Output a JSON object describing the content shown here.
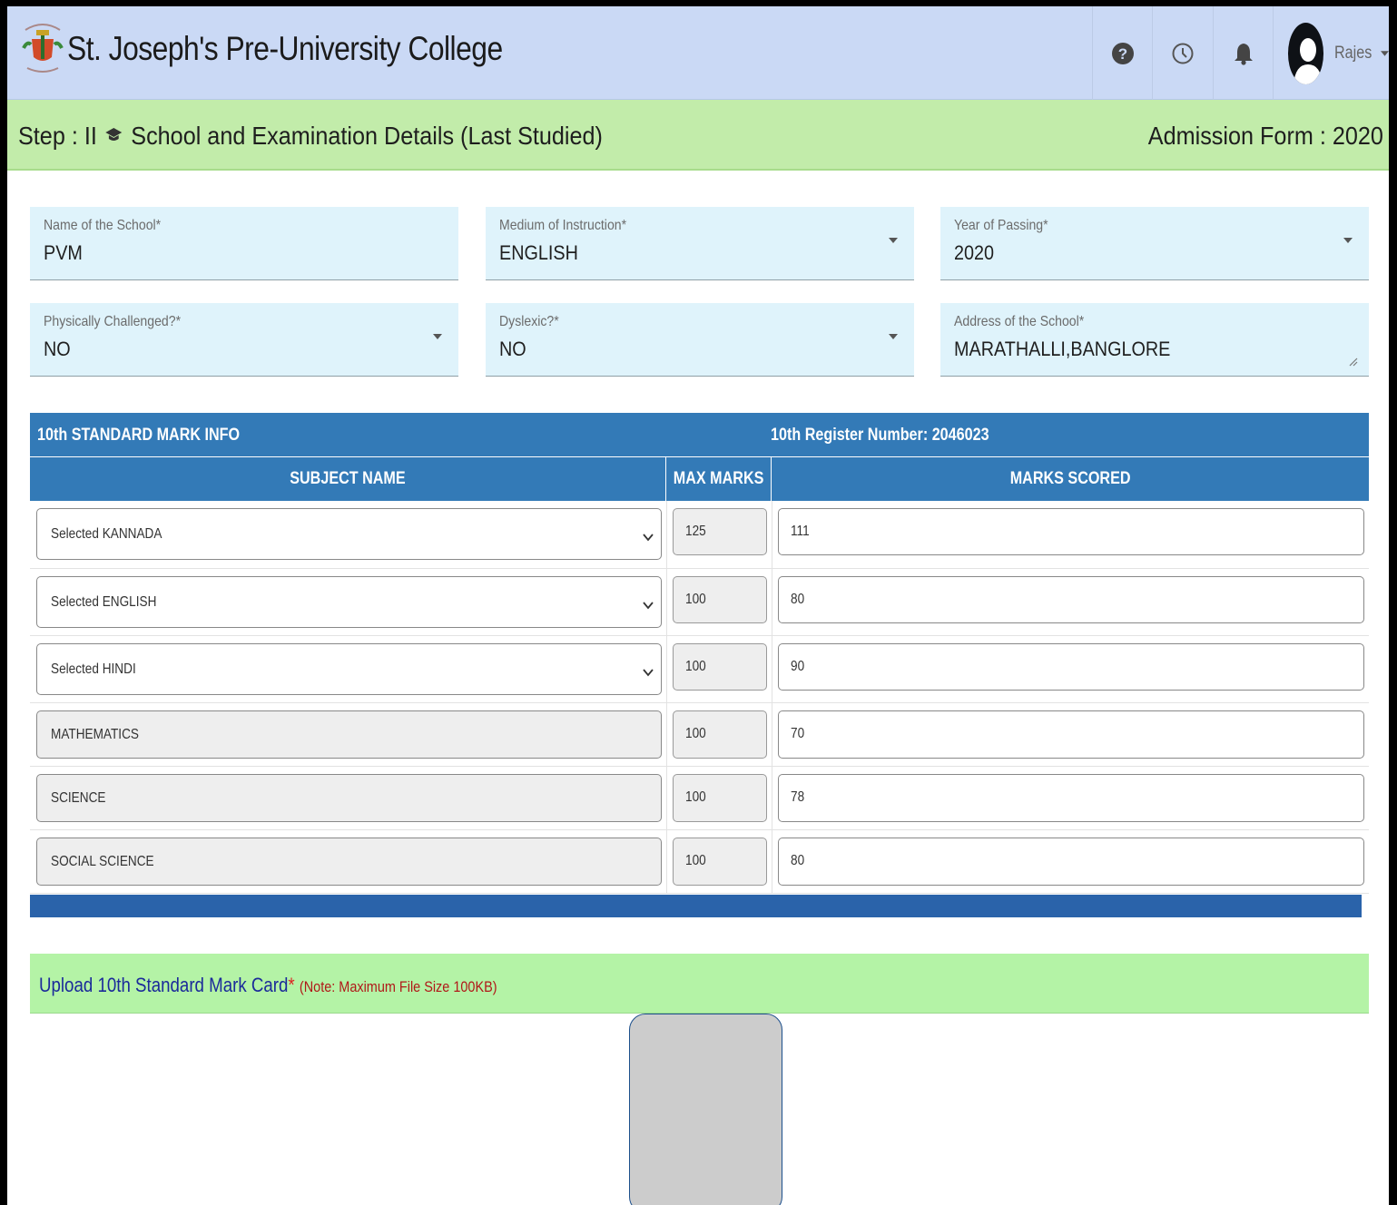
{
  "header": {
    "college_name": "St. Joseph's Pre-University College",
    "icons": [
      "help-icon",
      "clock-icon",
      "bell-icon"
    ],
    "user_name": "Rajes"
  },
  "step": {
    "label": "Step : II",
    "icon": "graduation-cap-icon",
    "title": "School and Examination Details (Last Studied)",
    "form_label": "Admission Form : 2020"
  },
  "fields": {
    "school_name": {
      "label": "Name of the School*",
      "value": "PVM"
    },
    "medium": {
      "label": "Medium of Instruction*",
      "value": "ENGLISH"
    },
    "year_of_passing": {
      "label": "Year of Passing*",
      "value": "2020"
    },
    "physically_challenged": {
      "label": "Physically Challenged?*",
      "value": "NO"
    },
    "dyslexic": {
      "label": "Dyslexic?*",
      "value": "NO"
    },
    "school_address": {
      "label": "Address of the School*",
      "value": "MARATHALLI,BANGLORE"
    }
  },
  "marks_table": {
    "title": "10th STANDARD MARK INFO",
    "register_number": "10th Register Number: 2046023",
    "columns": [
      "SUBJECT NAME",
      "MAX MARKS",
      "MARKS SCORED"
    ],
    "rows": [
      {
        "subject": "Selected KANNADA",
        "max": "125",
        "scored": "111",
        "selectable": true
      },
      {
        "subject": "Selected ENGLISH",
        "max": "100",
        "scored": "80",
        "selectable": true
      },
      {
        "subject": "Selected HINDI",
        "max": "100",
        "scored": "90",
        "selectable": true
      },
      {
        "subject": "MATHEMATICS",
        "max": "100",
        "scored": "70",
        "selectable": false
      },
      {
        "subject": "SCIENCE",
        "max": "100",
        "scored": "78",
        "selectable": false
      },
      {
        "subject": "SOCIAL SCIENCE",
        "max": "100",
        "scored": "80",
        "selectable": false
      }
    ]
  },
  "upload": {
    "title": "Upload 10th Standard Mark Card",
    "required_mark": "*",
    "note": "(Note: Maximum File Size 100KB)"
  },
  "colors": {
    "header_bg": "#cad9f5",
    "step_bg": "#c2ecaa",
    "field_bg": "#dff3fb",
    "table_header": "#337ab7",
    "upload_bg": "#b4f3a6"
  }
}
